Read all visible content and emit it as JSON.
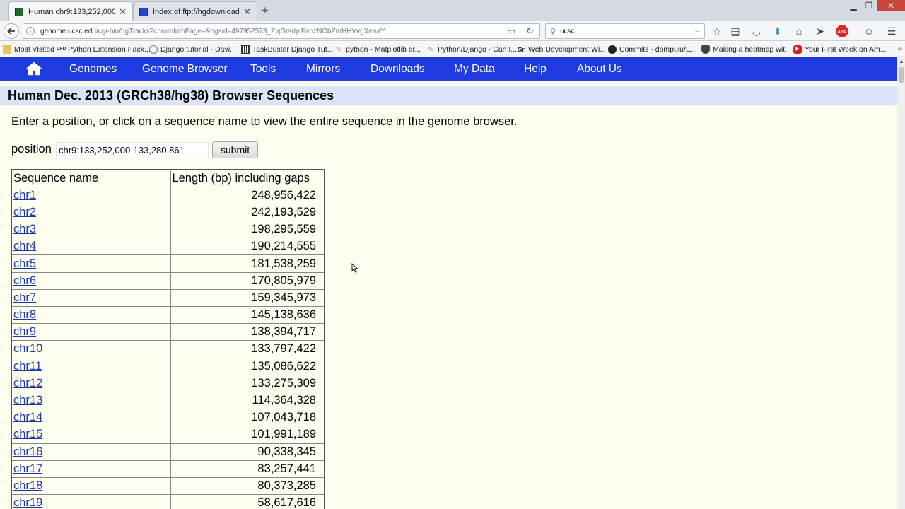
{
  "browser": {
    "tabs": [
      {
        "title": "Human chr9:133,252,000-1...",
        "active": true
      },
      {
        "title": "Index of ftp://hgdownload....",
        "active": false
      }
    ],
    "new_tab": "+",
    "url_host": "genome.ucsc.edu",
    "url_rest": "/cgi-bin/hgTracks?chromInfoPage=&hgsid=497952573_ZvjGrsdpiFabzNObZmHHVvgXeaaY",
    "search_value": "ucsc",
    "bookmarks": [
      "Most Visited",
      "Python Extension Pack...",
      "Django tutorial - Davi...",
      "TaskBuster Django Tut...",
      "python - Matplotlib er...",
      "Python/Django - Can I...",
      "Web Development Wi...",
      "Commits · dompuiu/E...",
      "Making a heatmap wit...",
      "Your First Week on Am..."
    ],
    "bookmark_more": "»",
    "toolbar_icons": [
      "reader-view-icon",
      "bookmark-star-icon",
      "reading-list-icon",
      "pocket-icon",
      "downloads-icon",
      "home-icon",
      "send-icon",
      "adblock-icon",
      "emoji-icon",
      "menu-icon"
    ]
  },
  "site_nav": {
    "items": [
      "Genomes",
      "Genome Browser",
      "Tools",
      "Mirrors",
      "Downloads",
      "My Data",
      "Help",
      "About Us"
    ]
  },
  "page": {
    "title": "Human Dec. 2013 (GRCh38/hg38) Browser Sequences",
    "intro": "Enter a position, or click on a sequence name to view the entire sequence in the genome browser.",
    "position_label": "position",
    "position_value": "chr9:133,252,000-133,280,861",
    "submit_label": "submit"
  },
  "table": {
    "headers": [
      "Sequence name",
      "Length (bp) including gaps"
    ],
    "rows": [
      [
        "chr1",
        "248,956,422"
      ],
      [
        "chr2",
        "242,193,529"
      ],
      [
        "chr3",
        "198,295,559"
      ],
      [
        "chr4",
        "190,214,555"
      ],
      [
        "chr5",
        "181,538,259"
      ],
      [
        "chr6",
        "170,805,979"
      ],
      [
        "chr7",
        "159,345,973"
      ],
      [
        "chr8",
        "145,138,636"
      ],
      [
        "chr9",
        "138,394,717"
      ],
      [
        "chr10",
        "133,797,422"
      ],
      [
        "chr11",
        "135,086,622"
      ],
      [
        "chr12",
        "133,275,309"
      ],
      [
        "chr13",
        "114,364,328"
      ],
      [
        "chr14",
        "107,043,718"
      ],
      [
        "chr15",
        "101,991,189"
      ],
      [
        "chr16",
        "90,338,345"
      ],
      [
        "chr17",
        "83,257,441"
      ],
      [
        "chr18",
        "80,373,285"
      ],
      [
        "chr19",
        "58,617,616"
      ]
    ]
  },
  "colors": {
    "site_nav_bg": "#1f3bdf",
    "title_bar_bg": "#d9e4f8",
    "page_bg": "#fffef0",
    "link": "#1a3aaa"
  }
}
